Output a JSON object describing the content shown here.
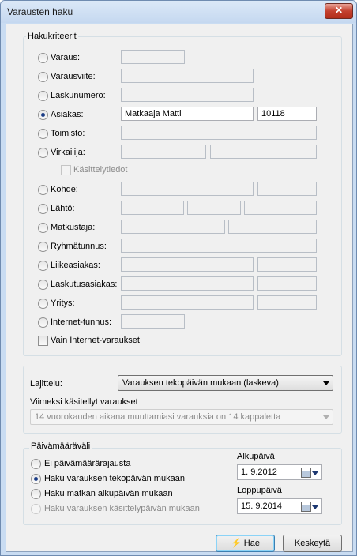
{
  "window": {
    "title": "Varausten haku",
    "close_symbol": "✕"
  },
  "criteria": {
    "group_label": "Hakukriteerit",
    "rows": [
      {
        "label": "Varaus:",
        "selected": false
      },
      {
        "label": "Varausviite:",
        "selected": false
      },
      {
        "label": "Laskunumero:",
        "selected": false
      },
      {
        "label": "Asiakas:",
        "selected": true,
        "value1": "Matkaaja Matti",
        "value2": "10118"
      },
      {
        "label": "Toimisto:",
        "selected": false
      },
      {
        "label": "Virkailija:",
        "selected": false
      },
      {
        "label": "Kohde:",
        "selected": false
      },
      {
        "label": "Lähtö:",
        "selected": false
      },
      {
        "label": "Matkustaja:",
        "selected": false
      },
      {
        "label": "Ryhmätunnus:",
        "selected": false
      },
      {
        "label": "Liikeasiakas:",
        "selected": false
      },
      {
        "label": "Laskutusasiakas:",
        "selected": false
      },
      {
        "label": "Yritys:",
        "selected": false
      },
      {
        "label": "Internet-tunnus:",
        "selected": false
      }
    ],
    "kasittelytiedot_label": "Käsittelytiedot",
    "internet_only_label": "Vain Internet-varaukset"
  },
  "sorting": {
    "label": "Lajittelu:",
    "selected": "Varauksen tekopäivän mukaan (laskeva)",
    "recent_label": "Viimeksi käsitellyt varaukset",
    "recent_value": "14 vuorokauden aikana muuttamiasi varauksia on 14  kappaletta"
  },
  "dates": {
    "group_label": "Päivämääräväli",
    "options": [
      {
        "label": "Ei päivämäärärajausta",
        "selected": false,
        "enabled": true
      },
      {
        "label": "Haku varauksen tekopäivän mukaan",
        "selected": true,
        "enabled": true
      },
      {
        "label": "Haku matkan alkupäivän  mukaan",
        "selected": false,
        "enabled": true
      },
      {
        "label": "Haku varauksen käsittelypäivän mukaan",
        "selected": false,
        "enabled": false
      }
    ],
    "start_label": "Alkupäivä",
    "start_value": "1.  9.2012",
    "end_label": "Loppupäivä",
    "end_value": "15.  9.2014"
  },
  "buttons": {
    "search_label": "Hae",
    "cancel_label": "Keskeytä"
  }
}
